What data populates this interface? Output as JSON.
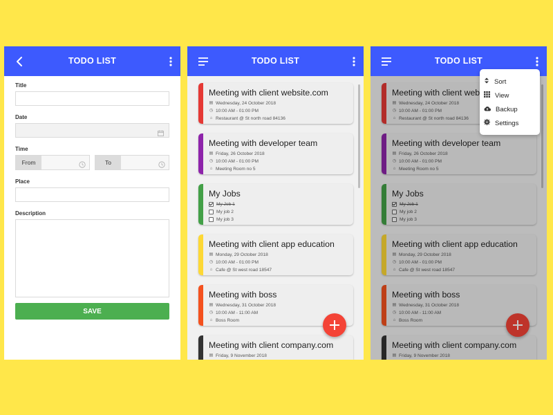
{
  "app": {
    "title": "TODO LIST"
  },
  "form": {
    "title_label": "Title",
    "date_label": "Date",
    "time_label": "Time",
    "from_label": "From",
    "to_label": "To",
    "place_label": "Place",
    "description_label": "Description",
    "save_label": "SAVE"
  },
  "cards": [
    {
      "color": "#E53935",
      "title": "Meeting with client website.com",
      "date": "Wednesday, 24 October 2018",
      "time": "10:00 AM - 01:00 PM",
      "place": "Restaurant @ St north road 84136"
    },
    {
      "color": "#8E24AA",
      "title": "Meeting with developer team",
      "date": "Friday, 26 October 2018",
      "time": "10:00 AM - 01:00 PM",
      "place": "Meeting Room no 5"
    },
    {
      "color": "#43A047",
      "title": "My Jobs",
      "jobs": [
        {
          "label": "My Job 1",
          "done": true
        },
        {
          "label": "My job 2",
          "done": false
        },
        {
          "label": "My job 3",
          "done": false
        }
      ]
    },
    {
      "color": "#FDD835",
      "title": "Meeting with client app education",
      "date": "Monday, 29 October 2018",
      "time": "10:00 AM - 01:00 PM",
      "place": "Cafe @ St west road 18547"
    },
    {
      "color": "#F4511E",
      "title": "Meeting with boss",
      "date": "Wednesday, 31 October 2018",
      "time": "10:00 AM - 11:00 AM",
      "place": "Boss Room"
    },
    {
      "color": "#333333",
      "title": "Meeting with client company.com",
      "date": "Friday, 9 November 2018"
    }
  ],
  "menu": {
    "sort_label": "Sort",
    "view_label": "View",
    "backup_label": "Backup",
    "settings_label": "Settings"
  },
  "icons": {
    "back": "back-arrow-icon",
    "menu": "hamburger-menu-icon",
    "more": "more-vertical-icon",
    "fab": "add-icon"
  },
  "colors": {
    "appbar": "#3D5AFE",
    "save": "#4CAF50",
    "fab": "#F44336",
    "background": "#FFE74A"
  }
}
